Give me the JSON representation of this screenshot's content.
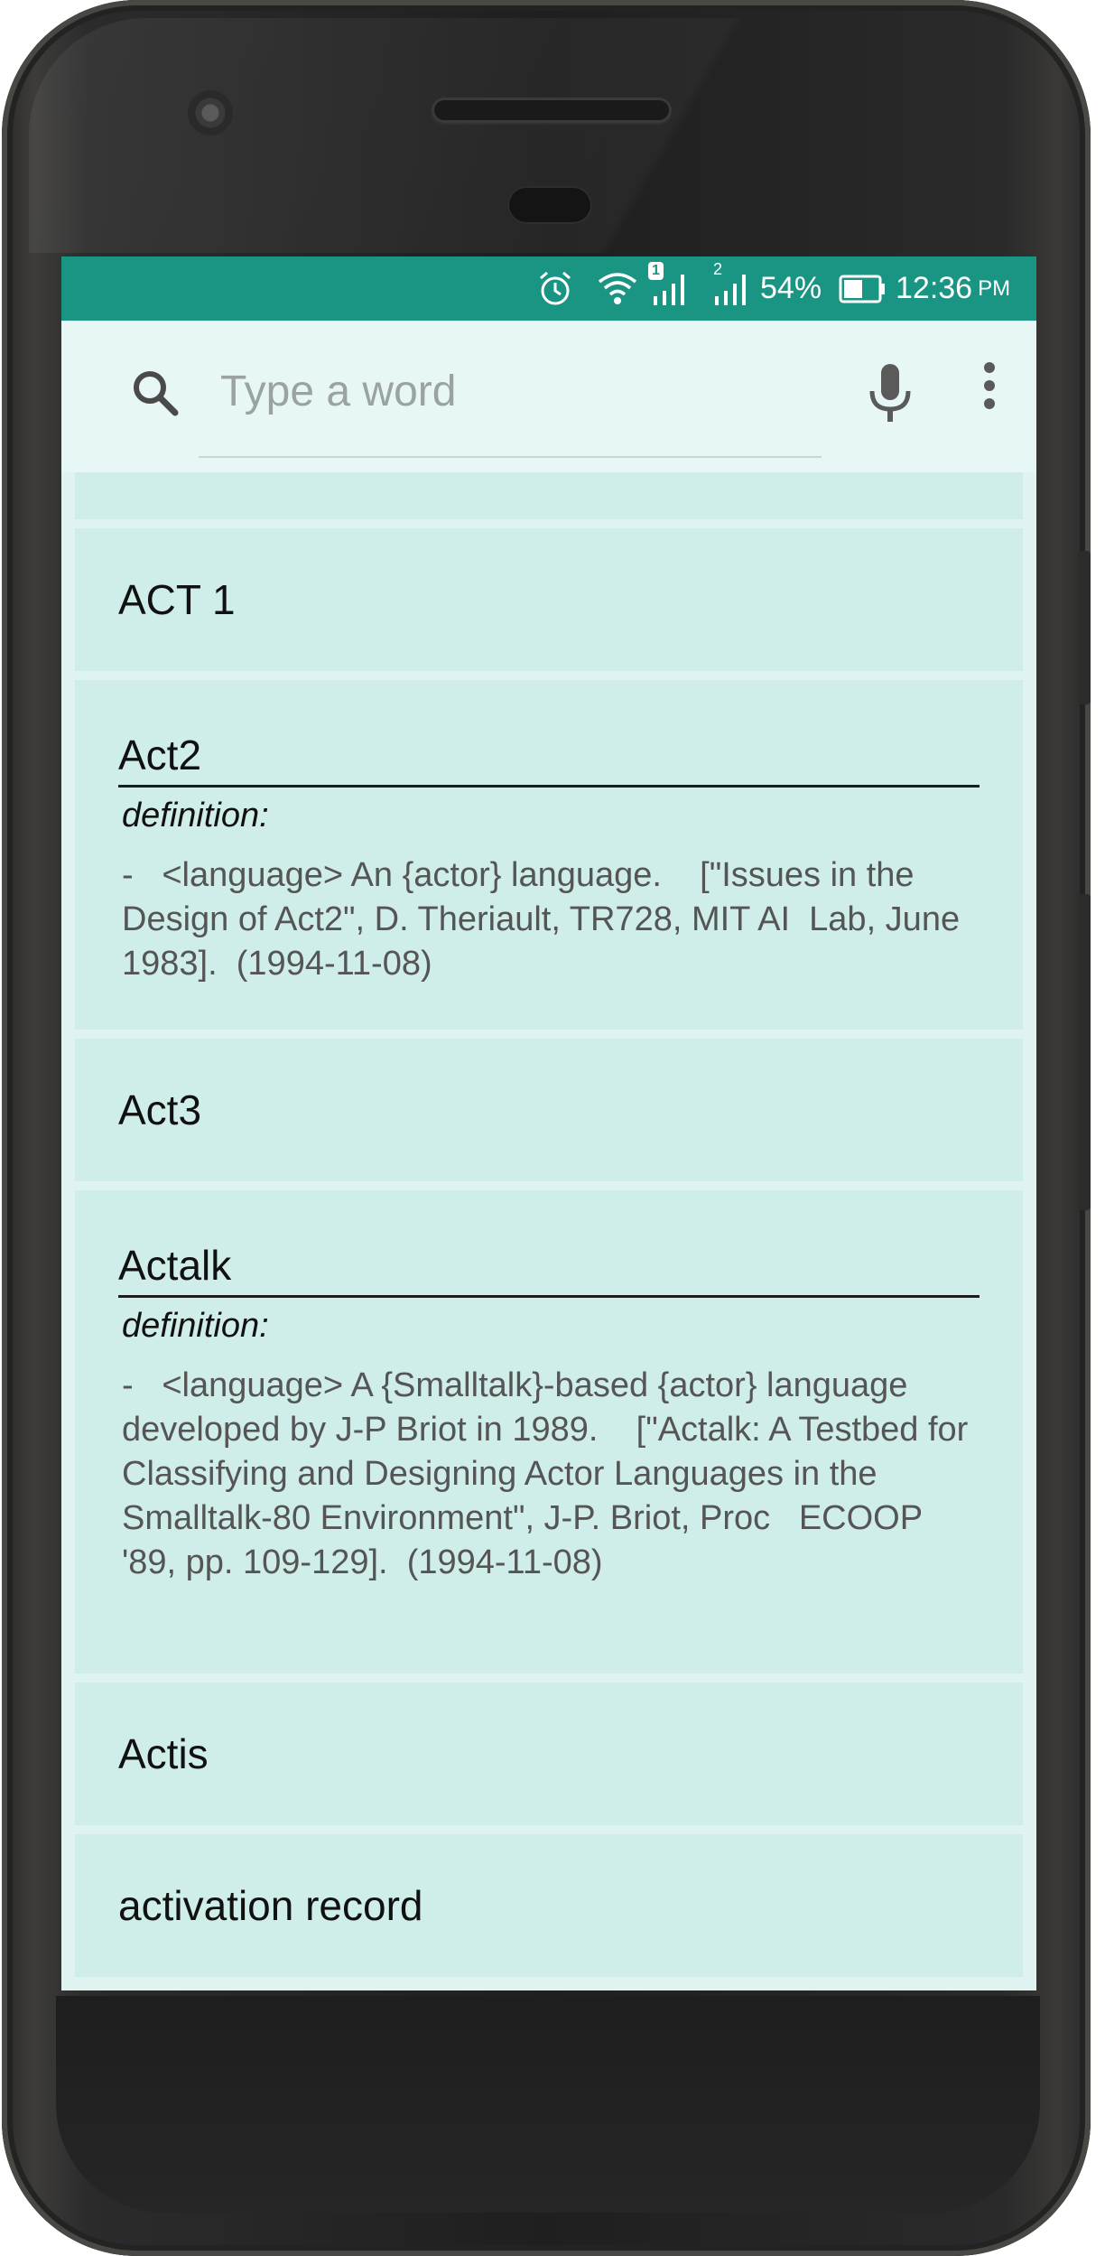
{
  "status_bar": {
    "sim1_badge": "1",
    "sim2_badge": "2",
    "battery": "54%",
    "time": "12:36",
    "ampm": "PM",
    "icons": [
      "alarm-icon",
      "wifi-icon",
      "signal-icon",
      "signal-icon",
      "battery-icon"
    ]
  },
  "search": {
    "placeholder": "Type a word"
  },
  "entries": [
    {
      "word": "ACT 1"
    },
    {
      "word": "Act2",
      "definition_label": "definition:",
      "definition": "-   <language> An {actor} language.    [\"Issues in the Design of Act2\", D. Theriault, TR728, MIT AI  Lab, June 1983].  (1994-11-08)"
    },
    {
      "word": "Act3"
    },
    {
      "word": "Actalk",
      "definition_label": "definition:",
      "definition": "-   <language> A {Smalltalk}-based {actor} language developed by J-P Briot in 1989.    [\"Actalk: A Testbed for Classifying and Designing Actor Languages in the Smalltalk-80 Environment\", J-P. Briot, Proc   ECOOP '89, pp. 109-129].  (1994-11-08)"
    },
    {
      "word": "Actis"
    },
    {
      "word": "activation record"
    }
  ],
  "colors": {
    "status_bar": "#1a9584",
    "card": "#cfeeea",
    "search_bar": "#e6f7f5"
  }
}
